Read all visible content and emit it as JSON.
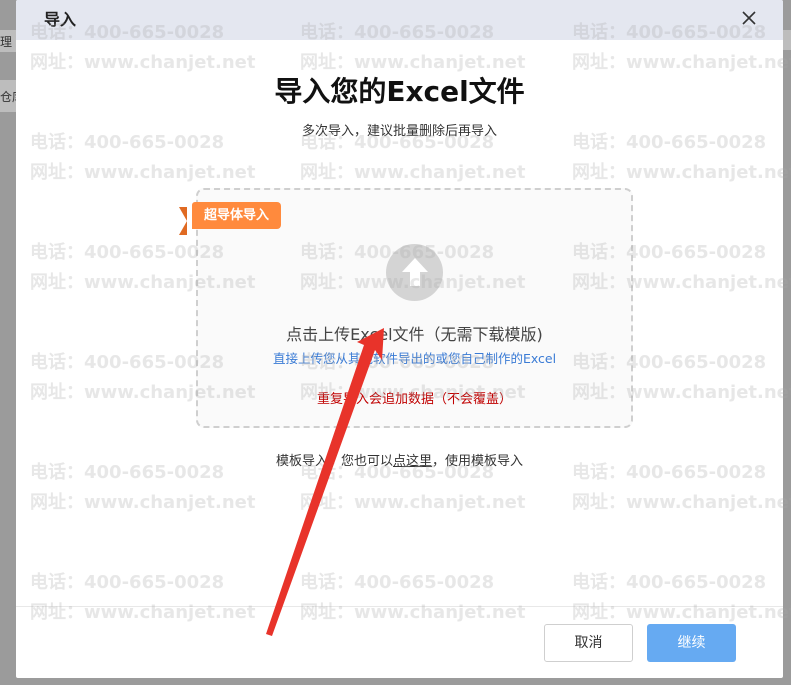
{
  "background": {
    "left_text_1": "理",
    "left_text_2": "仓库"
  },
  "dialog": {
    "title": "导入",
    "close_icon": "close-icon",
    "main_title": "导入您的Excel文件",
    "subtitle": "多次导入，建议批量删除后再导入"
  },
  "dropzone": {
    "ribbon": "超导体导入",
    "upload_icon": "upload-arrow-icon",
    "main_text": "点击上传Excel文件（无需下载模版)",
    "hint_text": "直接上传您从其他软件导出的或您自己制作的Excel",
    "warning_text": "重复导入会追加数据（不会覆盖）"
  },
  "template": {
    "prefix": "模板导入：您也可以",
    "link": "点这里",
    "suffix": "，使用模板导入"
  },
  "buttons": {
    "cancel": "取消",
    "continue": "继续"
  },
  "watermark": {
    "phone": "电话：400-665-0028",
    "site": "网址：www.chanjet.net"
  },
  "colors": {
    "header_bg": "#e4e7f0",
    "ribbon": "#ff8a3d",
    "hint": "#3a7bd5",
    "warning": "#c00000",
    "primary_button": "#66aaf2",
    "annotation_arrow": "#e8332a"
  }
}
